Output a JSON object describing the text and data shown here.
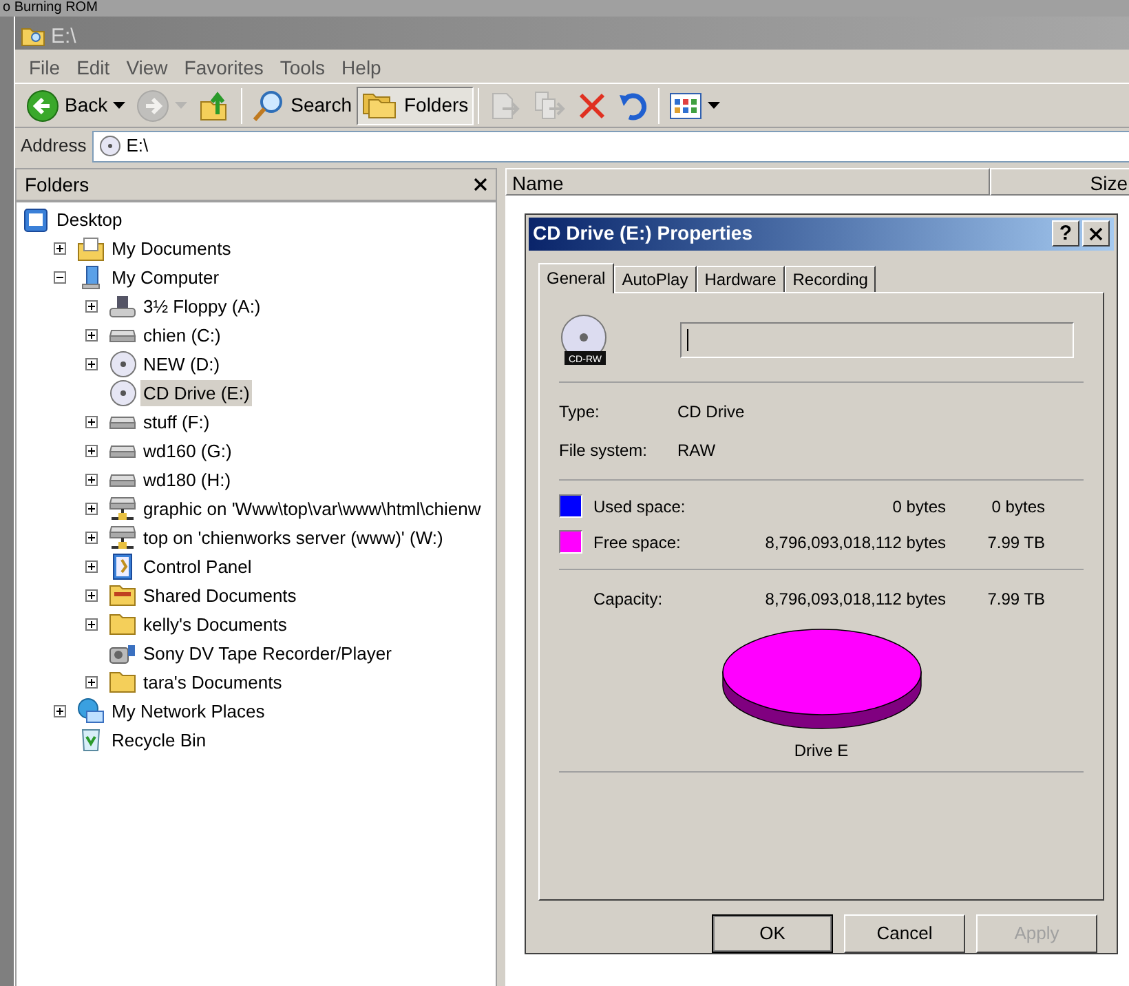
{
  "background_window": {
    "title": "o Burning ROM"
  },
  "window": {
    "title": "E:\\"
  },
  "menu": [
    "File",
    "Edit",
    "View",
    "Favorites",
    "Tools",
    "Help"
  ],
  "toolbar": [
    {
      "kind": "back",
      "label": "Back",
      "disabled": false
    },
    {
      "kind": "forward",
      "disabled": true
    },
    {
      "kind": "up",
      "disabled": false
    },
    {
      "kind": "separator"
    },
    {
      "kind": "search",
      "label": "Search",
      "pressed": false
    },
    {
      "kind": "folders",
      "label": "Folders",
      "pressed": true
    },
    {
      "kind": "separator"
    },
    {
      "kind": "move",
      "disabled": true
    },
    {
      "kind": "copy",
      "disabled": true
    },
    {
      "kind": "delete",
      "disabled": false
    },
    {
      "kind": "undo",
      "disabled": false
    },
    {
      "kind": "separator"
    },
    {
      "kind": "views",
      "disabled": false
    }
  ],
  "address": {
    "label": "Address",
    "value": "E:\\"
  },
  "folders_pane": {
    "title": "Folders",
    "tree": [
      {
        "label": "Desktop",
        "kind": "desktop",
        "selected": false,
        "children": [
          {
            "label": "My Documents",
            "kind": "documents",
            "expanded": false,
            "selected": false
          },
          {
            "label": "My Computer",
            "kind": "computer",
            "expanded": true,
            "selected": false,
            "children": [
              {
                "label": "3½ Floppy (A:)",
                "kind": "floppy",
                "expanded": false,
                "selected": false
              },
              {
                "label": "chien (C:)",
                "kind": "drive",
                "expanded": false,
                "selected": false
              },
              {
                "label": "NEW (D:)",
                "kind": "cd",
                "expanded": false,
                "selected": false
              },
              {
                "label": "CD Drive (E:)",
                "kind": "cd",
                "selected": true
              },
              {
                "label": "stuff (F:)",
                "kind": "drive",
                "expanded": false,
                "selected": false
              },
              {
                "label": "wd160 (G:)",
                "kind": "drive",
                "expanded": false,
                "selected": false
              },
              {
                "label": "wd180 (H:)",
                "kind": "drive",
                "expanded": false,
                "selected": false
              },
              {
                "label": "graphic on 'Www\\top\\var\\www\\html\\chienw",
                "kind": "netdrive",
                "expanded": false,
                "selected": false
              },
              {
                "label": "top on 'chienworks server (www)' (W:)",
                "kind": "netdrive",
                "expanded": false,
                "selected": false
              },
              {
                "label": "Control Panel",
                "kind": "control",
                "expanded": false,
                "selected": false
              },
              {
                "label": "Shared Documents",
                "kind": "shared",
                "expanded": false,
                "selected": false
              },
              {
                "label": "kelly's Documents",
                "kind": "folder",
                "expanded": false,
                "selected": false
              },
              {
                "label": "Sony DV Tape Recorder/Player",
                "kind": "camera",
                "selected": false
              },
              {
                "label": "tara's Documents",
                "kind": "folder",
                "expanded": false,
                "selected": false
              }
            ]
          },
          {
            "label": "My Network Places",
            "kind": "network",
            "expanded": false,
            "selected": false
          },
          {
            "label": "Recycle Bin",
            "kind": "recycle",
            "selected": false
          }
        ]
      }
    ]
  },
  "file_list": {
    "columns": [
      "Name",
      "Size"
    ]
  },
  "dialog": {
    "title": "CD Drive (E:) Properties",
    "help_label": "?",
    "tabs": [
      {
        "label": "General",
        "selected": true
      },
      {
        "label": "AutoPlay",
        "selected": false
      },
      {
        "label": "Hardware",
        "selected": false
      },
      {
        "label": "Recording",
        "selected": false
      }
    ],
    "drive_badge": "CD-RW",
    "info": [
      {
        "label": "Type:",
        "value": "CD Drive"
      },
      {
        "label": "File system:",
        "value": "RAW"
      }
    ],
    "space": [
      {
        "label": "Used space:",
        "bytes": "0 bytes",
        "size": "0 bytes",
        "color": "#0000ff"
      },
      {
        "label": "Free space:",
        "bytes": "8,796,093,018,112 bytes",
        "size": "7.99 TB",
        "color": "#ff00ff"
      }
    ],
    "capacity": {
      "label": "Capacity:",
      "bytes": "8,796,093,018,112 bytes",
      "size": "7.99 TB"
    },
    "chart_caption": "Drive E",
    "buttons": [
      {
        "label": "OK",
        "default": true,
        "disabled": false
      },
      {
        "label": "Cancel",
        "default": false,
        "disabled": false
      },
      {
        "label": "Apply",
        "default": false,
        "disabled": true
      }
    ]
  }
}
